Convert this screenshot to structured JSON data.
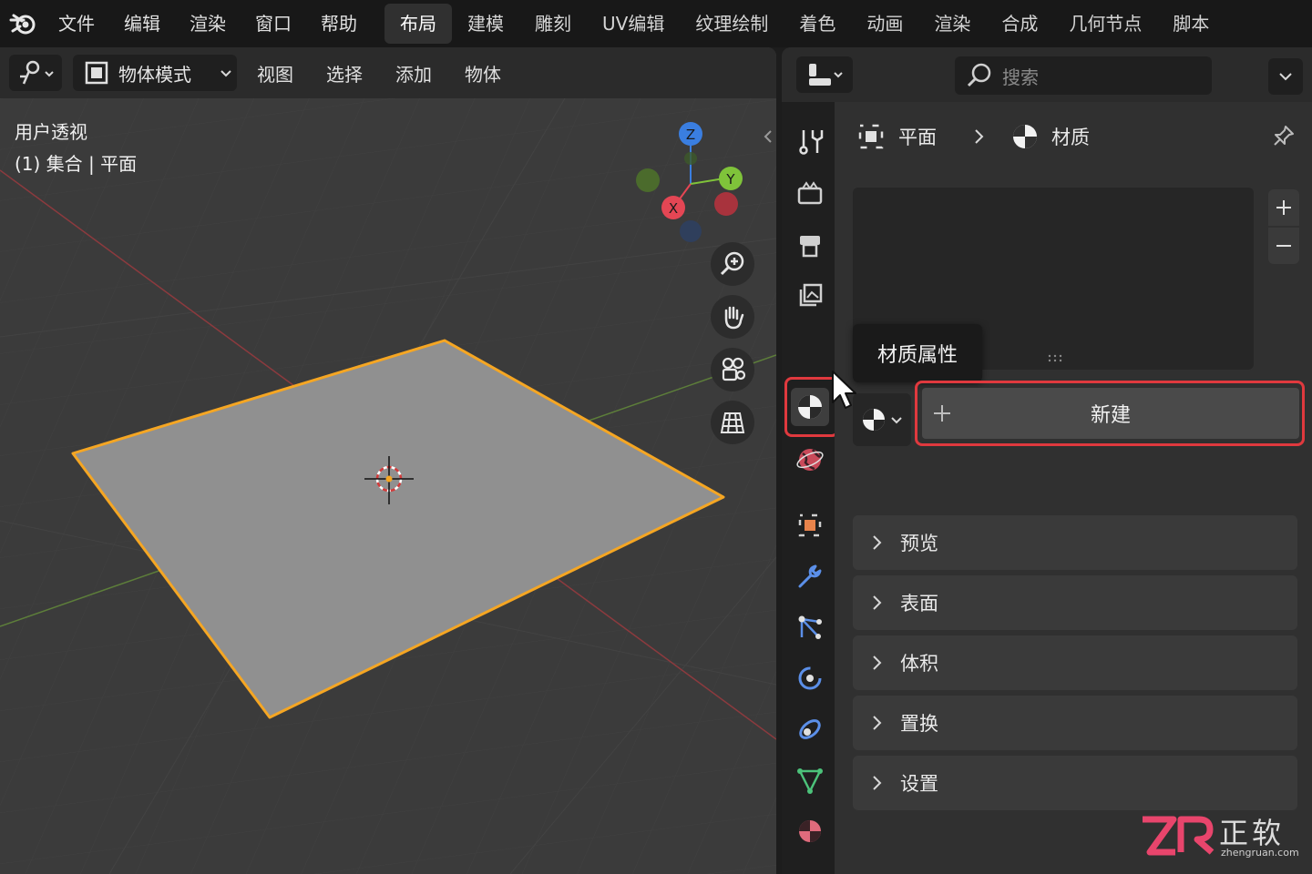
{
  "topbar": {
    "menu": [
      "文件",
      "编辑",
      "渲染",
      "窗口",
      "帮助"
    ],
    "workspaces": [
      "布局",
      "建模",
      "雕刻",
      "UV编辑",
      "纹理绘制",
      "着色",
      "动画",
      "渲染",
      "合成",
      "几何节点",
      "脚本"
    ],
    "active_workspace": "布局"
  },
  "viewport": {
    "mode_label": "物体模式",
    "menu": [
      "视图",
      "选择",
      "添加",
      "物体"
    ],
    "info_line1": "用户透视",
    "info_line2": "(1) 集合 | 平面",
    "gizmo": {
      "z": "Z",
      "y": "Y",
      "x": "X"
    },
    "colors": {
      "x_axis": "#e44654",
      "y_axis": "#7fc33a",
      "z_axis": "#3a7ee0",
      "selection": "#f5a623",
      "plane": "#909090"
    }
  },
  "properties": {
    "search_placeholder": "搜索",
    "breadcrumb": {
      "object": "平面",
      "section": "材质"
    },
    "tooltip": "材质属性",
    "new_button": "新建",
    "panels": [
      "预览",
      "表面",
      "体积",
      "置换",
      "设置"
    ],
    "highlight_color": "#e0393e"
  },
  "watermark": {
    "brand": "正软",
    "domain": "zhengruan.com"
  }
}
